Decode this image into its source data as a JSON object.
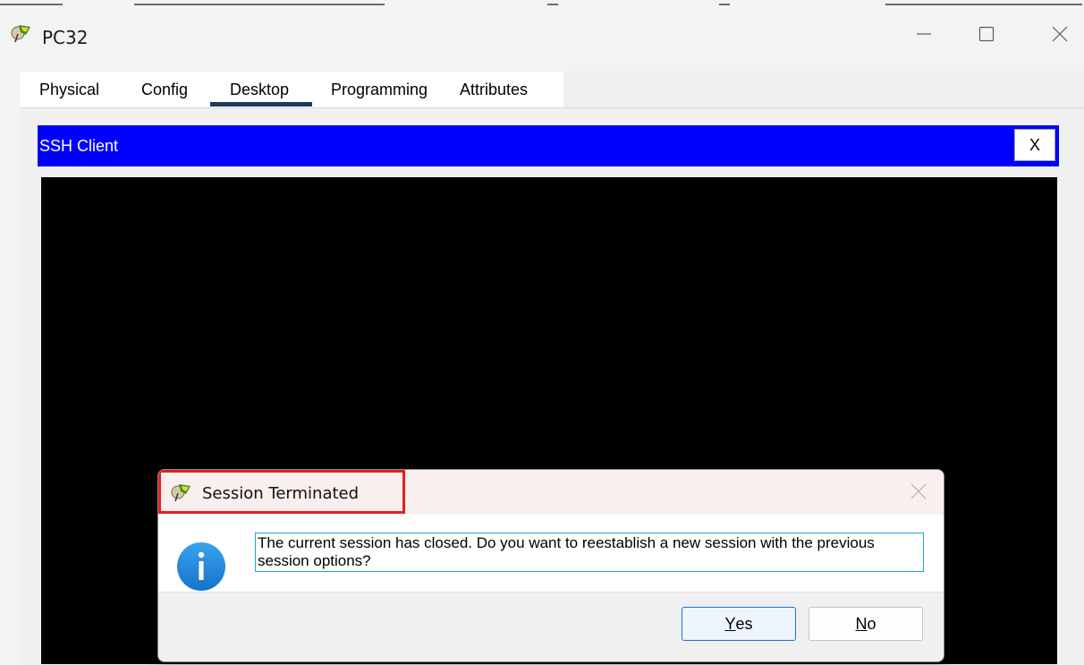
{
  "window": {
    "title": "PC32",
    "controls": [
      "minimize-icon",
      "maximize-icon",
      "close-icon"
    ]
  },
  "tabs": [
    {
      "label": "Physical",
      "active": false
    },
    {
      "label": "Config",
      "active": false
    },
    {
      "label": "Desktop",
      "active": true
    },
    {
      "label": "Programming",
      "active": false
    },
    {
      "label": "Attributes",
      "active": false
    }
  ],
  "ssh_client": {
    "title": "SSH Client",
    "close_label": "X"
  },
  "dialog": {
    "title": "Session Terminated",
    "message": "The current session has closed. Do you want to reestablish a new session with the previous session options?",
    "buttons": {
      "yes": {
        "mnemonic": "Y",
        "rest": "es"
      },
      "no": {
        "mnemonic": "N",
        "rest": "o"
      }
    }
  },
  "colors": {
    "ssh_bar": "#0000ff",
    "terminal_bg": "#000000",
    "highlight_box": "#e02020",
    "info_icon": "#1b8be0"
  }
}
